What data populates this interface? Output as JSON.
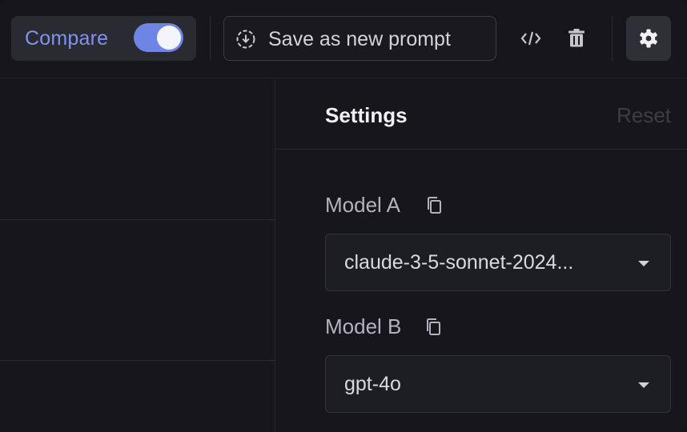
{
  "toolbar": {
    "compare_label": "Compare",
    "compare_enabled": true,
    "save_label": "Save as new prompt",
    "icons": {
      "save": "download-circle-icon",
      "code": "code-icon",
      "delete": "trash-icon",
      "settings": "gear-icon"
    }
  },
  "settings": {
    "title": "Settings",
    "reset_label": "Reset",
    "model_a": {
      "label": "Model A",
      "value": "claude-3-5-sonnet-2024..."
    },
    "model_b": {
      "label": "Model B",
      "value": "gpt-4o"
    }
  },
  "colors": {
    "accent": "#6f85e6",
    "accent_text": "#7f93ef",
    "background": "#16161c"
  }
}
